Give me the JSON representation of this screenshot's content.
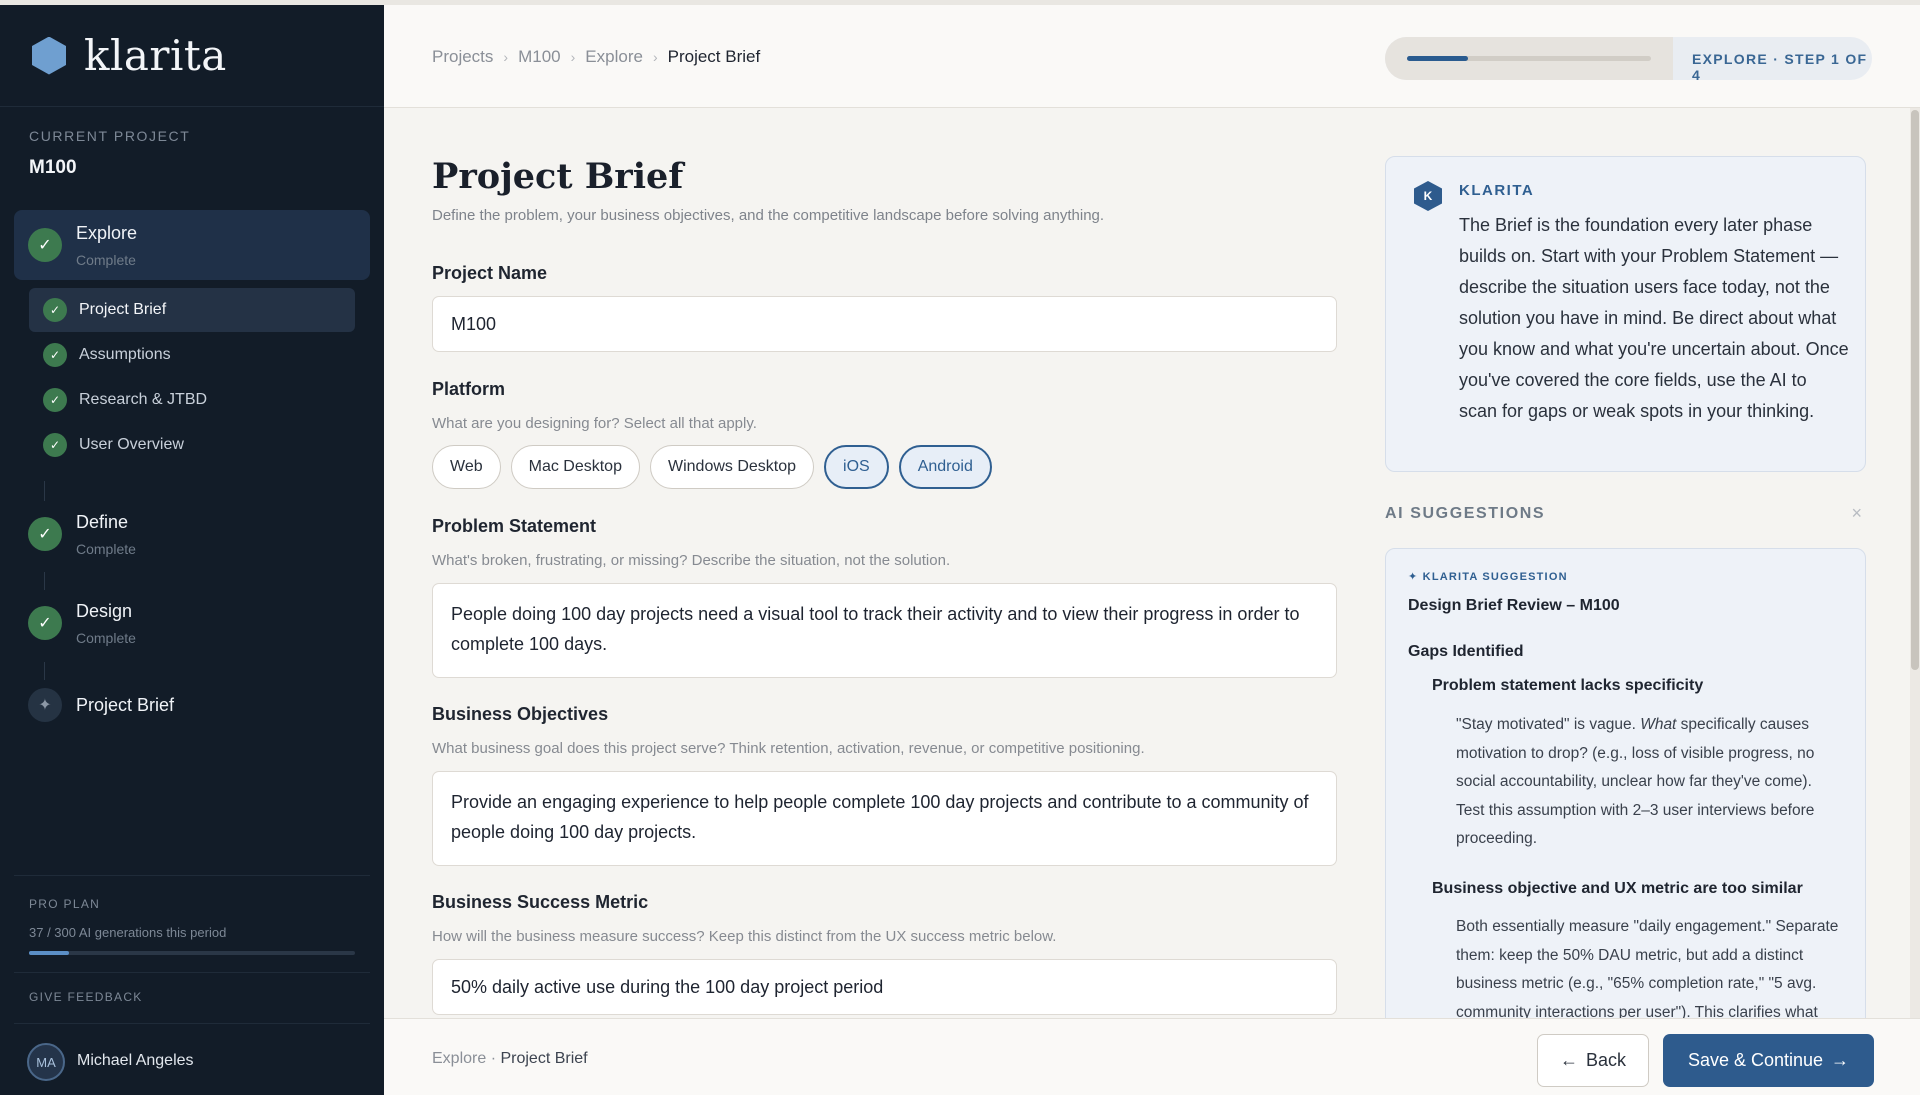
{
  "brand": {
    "name": "klarita"
  },
  "sidebar": {
    "current_project_label": "CURRENT PROJECT",
    "current_project": "M100",
    "phases": [
      {
        "title": "Explore",
        "status": "Complete"
      },
      {
        "title": "Define",
        "status": "Complete"
      },
      {
        "title": "Design",
        "status": "Complete"
      },
      {
        "title": "Project Brief"
      }
    ],
    "explore_steps": [
      {
        "label": "Project Brief"
      },
      {
        "label": "Assumptions"
      },
      {
        "label": "Research & JTBD"
      },
      {
        "label": "User Overview"
      }
    ],
    "plan_label": "PRO PLAN",
    "plan_usage": "37 / 300 AI generations this period",
    "plan_fraction": 0.123,
    "feedback_label": "GIVE FEEDBACK",
    "user": {
      "initials": "MA",
      "name": "Michael Angeles"
    }
  },
  "header": {
    "breadcrumbs": [
      "Projects",
      "M100",
      "Explore",
      "Project Brief"
    ],
    "step_text": "EXPLORE · STEP 1 OF 4",
    "step_fraction": 0.25
  },
  "main": {
    "title": "Project Brief",
    "subtitle": "Define the problem, your business objectives, and the competitive landscape before solving anything.",
    "project_name": {
      "label": "Project Name",
      "value": "M100"
    },
    "platform": {
      "label": "Platform",
      "help": "What are you designing for? Select all that apply.",
      "options": [
        "Web",
        "Mac Desktop",
        "Windows Desktop",
        "iOS",
        "Android"
      ],
      "selected": [
        "iOS",
        "Android"
      ]
    },
    "problem": {
      "label": "Problem Statement",
      "help": "What's broken, frustrating, or missing? Describe the situation, not the solution.",
      "value": "People doing 100 day projects need a visual tool to track their activity and to view their progress in order to complete 100 days."
    },
    "objectives": {
      "label": "Business Objectives",
      "help": "What business goal does this project serve? Think retention, activation, revenue, or competitive positioning.",
      "value": "Provide an engaging experience to help people complete 100 day projects and contribute to a community of people doing 100 day projects."
    },
    "metric": {
      "label": "Business Success Metric",
      "help": "How will the business measure success? Keep this distinct from the UX success metric below.",
      "value": "50% daily active use during the 100 day project period"
    }
  },
  "assistant": {
    "badge": "K",
    "name": "KLARITA",
    "message": "The Brief is the foundation every later phase builds on. Start with your Problem Statement — describe the situation users face today, not the solution you have in mind. Be direct about what you know and what you're uncertain about. Once you've covered the core fields, use the AI to scan for gaps or weak spots in your thinking.",
    "suggestions_label": "AI SUGGESTIONS",
    "close": "×",
    "suggestion": {
      "tag": "✦ KLARITA SUGGESTION",
      "title": "Design Brief Review – M100",
      "heading": "Gaps Identified",
      "item1_title": "Problem statement lacks specificity",
      "item1_pre": "\"Stay motivated\" is vague. ",
      "item1_em": "What",
      "item1_post": " specifically causes motivation to drop? (e.g., loss of visible progress, no social accountability, unclear how far they've come). Test this assumption with 2–3 user interviews before proceeding.",
      "item2_title": "Business objective and UX metric are too similar",
      "item2_body": "Both essentially measure \"daily engagement.\" Separate them: keep the 50% DAU metric, but add a distinct business metric (e.g., \"65% completion rate,\" \"5 avg. community interactions per user\"). This clarifies what"
    }
  },
  "footer": {
    "crumb_phase": "Explore",
    "crumb_sep": " · ",
    "crumb_step": "Project Brief",
    "back_label": "Back",
    "back_icon": "←",
    "save_label": "Save & Continue",
    "save_icon": "→"
  },
  "icons": {
    "check": "✓",
    "sparkle": "✦",
    "breadcrumb_sep": "›"
  }
}
